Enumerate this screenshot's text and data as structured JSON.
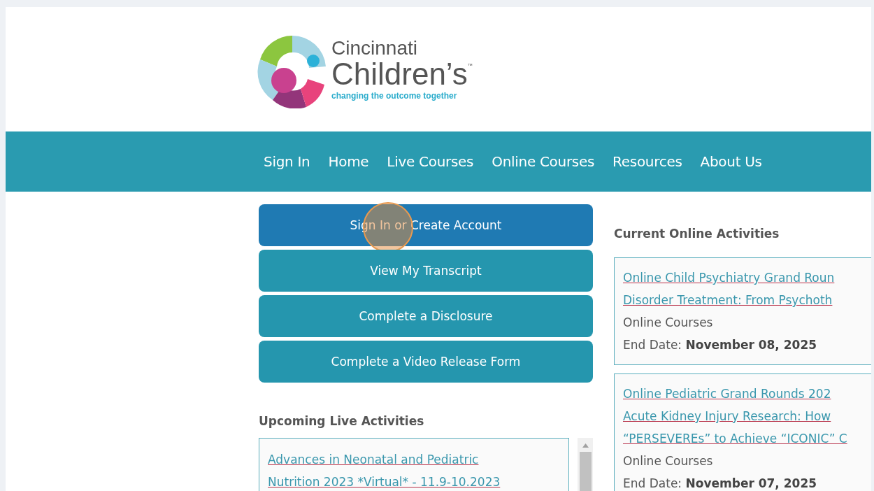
{
  "logo": {
    "line1": "Cincinnati",
    "line2": "Children’s",
    "trademark": "™",
    "tagline": "changing the outcome together"
  },
  "nav": [
    {
      "label": "Sign In"
    },
    {
      "label": "Home"
    },
    {
      "label": "Live Courses"
    },
    {
      "label": "Online Courses"
    },
    {
      "label": "Resources"
    },
    {
      "label": "About Us"
    }
  ],
  "actions": [
    {
      "label": "Sign In or Create Account",
      "highlighted": true,
      "click_indicator": true
    },
    {
      "label": "View My Transcript",
      "highlighted": false,
      "click_indicator": false
    },
    {
      "label": "Complete a Disclosure",
      "highlighted": false,
      "click_indicator": false
    },
    {
      "label": "Complete a Video Release Form",
      "highlighted": false,
      "click_indicator": false
    }
  ],
  "upcoming": {
    "heading": "Upcoming Live Activities",
    "items": [
      {
        "title_lines": [
          "Advances in Neonatal and Pediatric",
          "Nutrition 2023 *Virtual* - 11.9-10.2023"
        ]
      }
    ]
  },
  "online": {
    "heading": "Current Online Activities",
    "items": [
      {
        "title_lines": [
          "Online Child Psychiatry Grand Roun",
          "Disorder Treatment: From Psychoth"
        ],
        "category": "Online Courses",
        "end_label": "End Date:",
        "end_date": "November 08, 2025"
      },
      {
        "title_lines": [
          "Online Pediatric Grand Rounds 202",
          "Acute Kidney Injury Research: How",
          "“PERSEVEREs” to Achieve “ICONIC” C"
        ],
        "category": "Online Courses",
        "end_label": "End Date:",
        "end_date": "November 07, 2025"
      }
    ]
  }
}
